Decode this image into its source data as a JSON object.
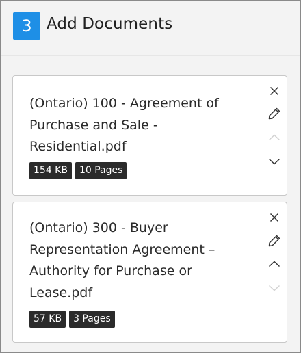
{
  "header": {
    "step_number": "3",
    "title": "Add Documents",
    "accent_color": "#1e8fe6"
  },
  "documents": [
    {
      "name": "(Ontario) 100 - Agreement of Purchase and Sale - Residential.pdf",
      "size": "154 KB",
      "pages": "10 Pages",
      "move_up_enabled": false,
      "move_down_enabled": true
    },
    {
      "name": "(Ontario) 300 - Buyer Representation Agreement – Authority for Purchase or Lease.pdf",
      "size": "57 KB",
      "pages": "3 Pages",
      "move_up_enabled": true,
      "move_down_enabled": false
    }
  ],
  "icons": {
    "remove": "close-icon",
    "edit": "pencil-icon",
    "move_up": "chevron-up-icon",
    "move_down": "chevron-down-icon"
  }
}
